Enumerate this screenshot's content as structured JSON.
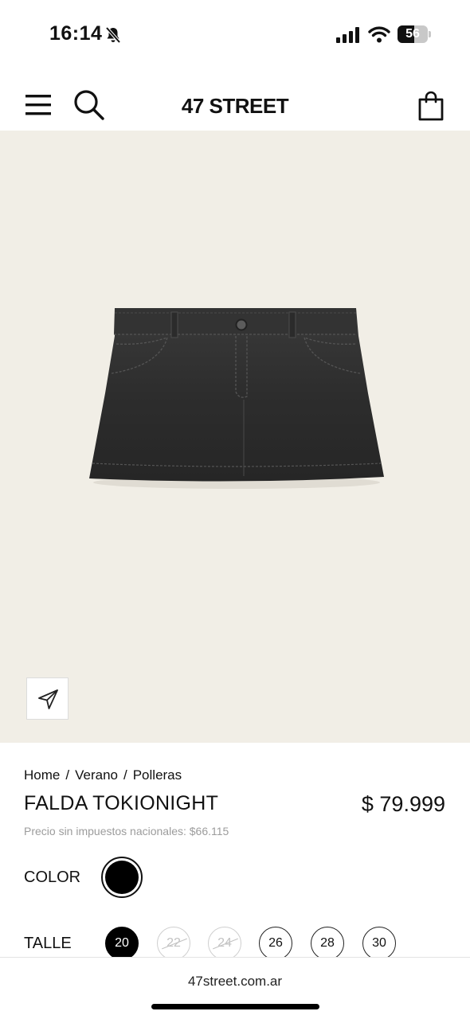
{
  "status_bar": {
    "time": "16:14",
    "battery_level": "56",
    "battery_fraction": 0.56,
    "icons": [
      "bell-slash-icon",
      "signal-icon",
      "wifi-icon",
      "battery-icon"
    ]
  },
  "header": {
    "logo": "47 STREET",
    "icons": [
      "menu-icon",
      "search-icon",
      "shopping-bag-icon"
    ]
  },
  "product": {
    "image": "black-denim-mini-skirt",
    "share_icon": "send-icon",
    "breadcrumb": [
      "Home",
      "Verano",
      "Polleras"
    ],
    "breadcrumb_separator": "/",
    "title": "FALDA TOKIONIGHT",
    "price": "$ 79.999",
    "tax_note": "Precio sin impuestos nacionales: $66.115",
    "color_label": "COLOR",
    "selected_color": "#000000",
    "size_label": "TALLE",
    "sizes": [
      "20",
      "22",
      "24",
      "26",
      "28",
      "30"
    ],
    "selected_size": "20",
    "unavailable_sizes": [
      "22",
      "24"
    ]
  },
  "browser": {
    "url": "47street.com.ar"
  },
  "colors": {
    "hero_background": "#f1eee6",
    "text": "#111111",
    "muted": "#9c9c9c"
  }
}
